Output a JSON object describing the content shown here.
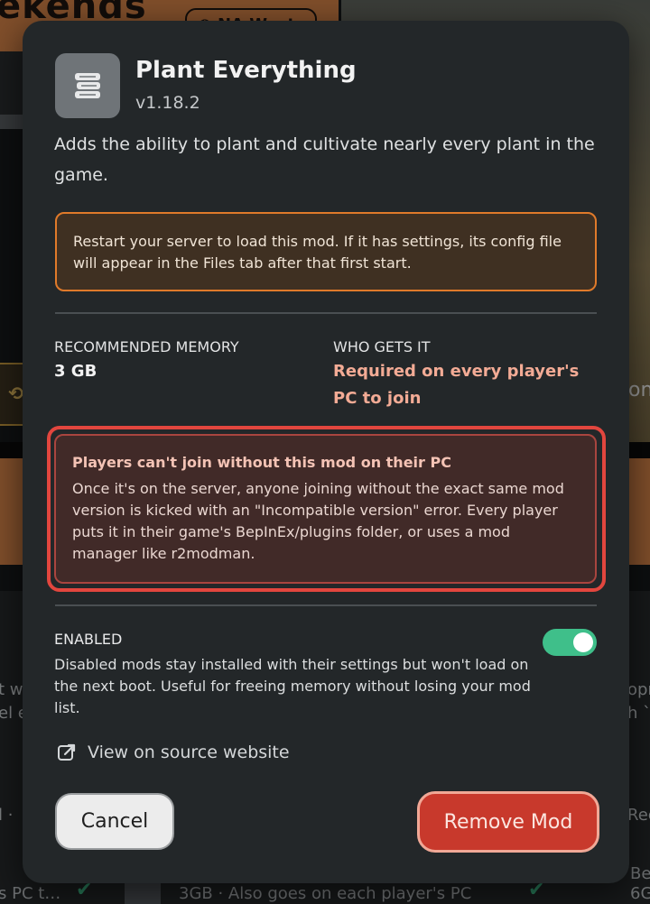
{
  "background": {
    "banner_text": "ekends",
    "region_pill": "NA West",
    "right_edge_text": "on",
    "left_side_lines": [
      "t w",
      "el e"
    ],
    "right_side_lines": [
      "opr",
      "h `"
    ],
    "left_footer_dot": "l ·",
    "right_footer_text": "Rec",
    "bottom_left_text": "s PC t…",
    "bottom_center_text": "3GB · Also goes on each player's PC",
    "bottom_right_lines": [
      "Be",
      "6G"
    ]
  },
  "modal": {
    "icon": "stack-icon",
    "title": "Plant Everything",
    "version": "v1.18.2",
    "description": "Adds the ability to plant and cultivate nearly every plant in the game.",
    "restart_notice": "Restart your server to load this mod. If it has settings, its config file will appear in the Files tab after that first start.",
    "stats": {
      "memory_label": "RECOMMENDED MEMORY",
      "memory_value": "3 GB",
      "who_label": "WHO GETS IT",
      "who_value": "Required on every player's PC to join"
    },
    "warning": {
      "title": "Players can't join without this mod on their PC",
      "body": "Once it's on the server, anyone joining without the exact same mod version is kicked with an \"Incompatible version\" error. Every player puts it in their game's BepInEx/plugins folder, or uses a mod manager like r2modman."
    },
    "enabled": {
      "label": "ENABLED",
      "description": "Disabled mods stay installed with their settings but won't load on the next boot. Useful for freeing memory without losing your mod list.",
      "state": true
    },
    "source_link": "View on source website",
    "cancel_label": "Cancel",
    "remove_label": "Remove Mod"
  },
  "colors": {
    "accent_green": "#3fbf8a",
    "danger_red": "#c8392c",
    "notice_orange": "#e07a2a",
    "highlight_salmon": "#f3ab95"
  }
}
